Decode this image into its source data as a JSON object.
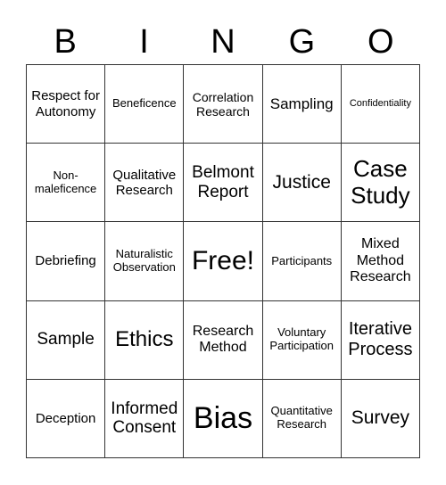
{
  "header": {
    "letters": [
      "B",
      "I",
      "N",
      "G",
      "O"
    ]
  },
  "grid": {
    "rows": [
      [
        "Respect for Autonomy",
        "Beneficence",
        "Correlation Research",
        "Sampling",
        "Confidentiality"
      ],
      [
        "Non-maleficence",
        "Qualitative Research",
        "Belmont Report",
        "Justice",
        "Case Study"
      ],
      [
        "Debriefing",
        "Naturalistic Observation",
        "Free!",
        "Participants",
        "Mixed Method Research"
      ],
      [
        "Sample",
        "Ethics",
        "Research Method",
        "Voluntary Participation",
        "Iterative Process"
      ],
      [
        "Deception",
        "Informed Consent",
        "Bias",
        "Quantitative Research",
        "Survey"
      ]
    ]
  }
}
